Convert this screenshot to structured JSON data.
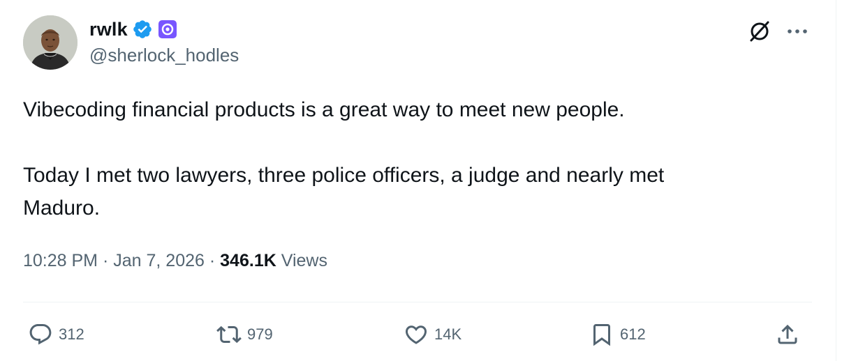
{
  "author": {
    "display_name": "rwlk",
    "handle": "@sherlock_hodles",
    "avatar_icon": "user-avatar",
    "verified_icon": "verified-badge-icon",
    "affiliate_icon": "affiliate-badge-icon",
    "verified_color": "#1d9bf0",
    "affiliate_color": "#7856ff"
  },
  "header_actions": {
    "grok_icon": "grok-icon",
    "more_icon": "more-options-icon"
  },
  "tweet": {
    "paragraph_1": "Vibecoding financial products is a great way to meet new people.",
    "paragraph_2_line_1": "Today I met two lawyers, three police officers, a judge and nearly met",
    "paragraph_2_line_2": "Maduro."
  },
  "meta": {
    "time": "10:28 PM",
    "separator": "·",
    "date": "Jan 7, 2026",
    "views_count": "346.1K",
    "views_label": "Views"
  },
  "actions": {
    "replies": "312",
    "reposts": "979",
    "likes": "14K",
    "bookmarks": "612"
  },
  "colors": {
    "text_primary": "#0f1419",
    "text_secondary": "#536471",
    "divider": "#eff3f4"
  }
}
